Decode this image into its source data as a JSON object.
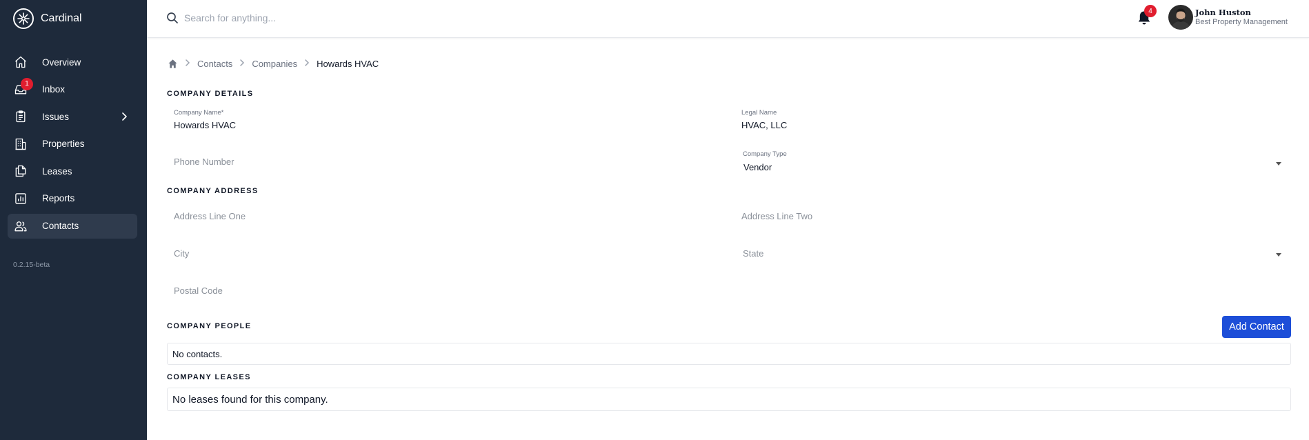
{
  "app": {
    "name": "Cardinal",
    "version": "0.2.15-beta"
  },
  "sidebar": {
    "items": [
      {
        "label": "Overview",
        "icon": "home-icon"
      },
      {
        "label": "Inbox",
        "icon": "inbox-icon",
        "badge": "1"
      },
      {
        "label": "Issues",
        "icon": "clipboard-icon"
      },
      {
        "label": "Properties",
        "icon": "building-icon"
      },
      {
        "label": "Leases",
        "icon": "documents-icon"
      },
      {
        "label": "Reports",
        "icon": "chart-icon"
      },
      {
        "label": "Contacts",
        "icon": "users-icon",
        "active": true
      }
    ]
  },
  "header": {
    "search_placeholder": "Search for anything...",
    "notifications_count": "4",
    "user": {
      "name": "John Huston",
      "organization": "Best Property Management"
    }
  },
  "breadcrumb": {
    "items": [
      "Contacts",
      "Companies",
      "Howards HVAC"
    ]
  },
  "company_details": {
    "title": "COMPANY DETAILS",
    "company_name_label": "Company Name",
    "company_name_required": "*",
    "company_name_value": "Howards HVAC",
    "legal_name_label": "Legal Name",
    "legal_name_value": "HVAC, LLC",
    "phone_placeholder": "Phone Number",
    "company_type_label": "Company Type",
    "company_type_value": "Vendor"
  },
  "company_address": {
    "title": "COMPANY ADDRESS",
    "address_line_one_placeholder": "Address Line One",
    "address_line_two_placeholder": "Address Line Two",
    "city_placeholder": "City",
    "state_placeholder": "State",
    "postal_code_placeholder": "Postal Code"
  },
  "company_people": {
    "title": "COMPANY PEOPLE",
    "add_contact_label": "Add Contact",
    "empty_text": "No contacts."
  },
  "company_leases": {
    "title": "COMPANY LEASES",
    "empty_text": "No leases found for this company."
  },
  "colors": {
    "sidebar_bg": "#1e2a3b",
    "sidebar_active": "#2f3b4d",
    "badge": "#e11d2e",
    "primary_button": "#1d4ed8"
  }
}
